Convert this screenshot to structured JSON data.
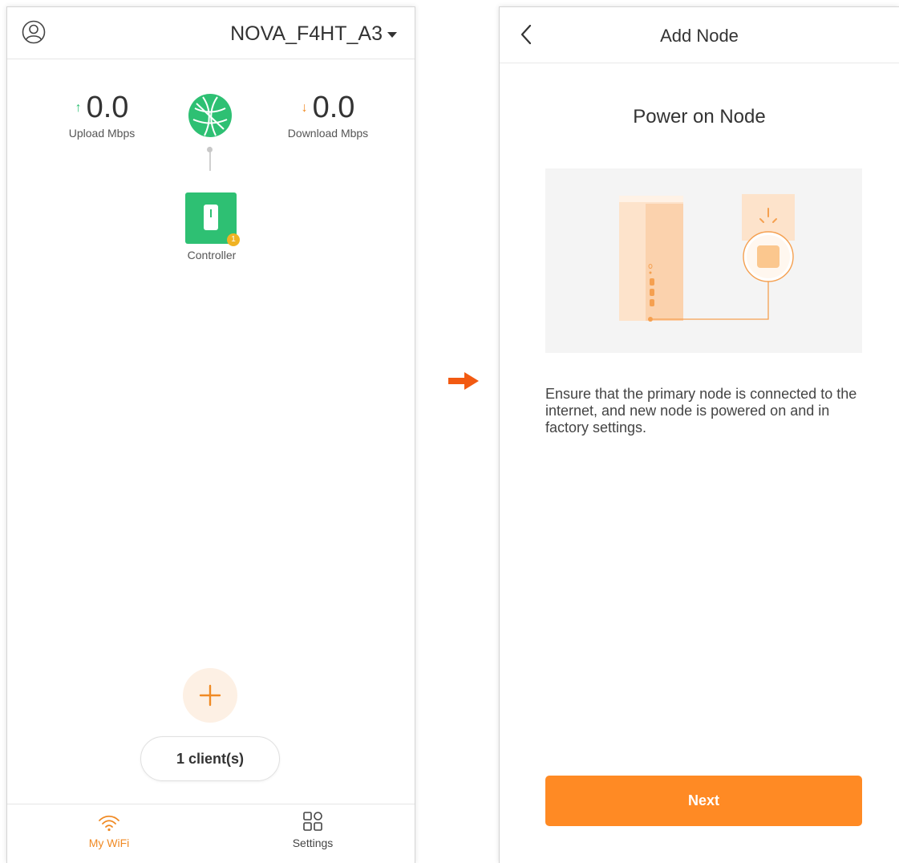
{
  "left_screen": {
    "header": {
      "ssid": "NOVA_F4HT_A3"
    },
    "upload": {
      "value": "0.0",
      "label": "Upload Mbps",
      "arrow": "↑"
    },
    "download": {
      "value": "0.0",
      "label": "Download Mbps",
      "arrow": "↓"
    },
    "controller": {
      "label": "Controller",
      "badge": "1"
    },
    "clients_button": {
      "label": "1 client(s)"
    },
    "tabs": [
      {
        "label": "My WiFi",
        "icon": "wifi-icon",
        "active": true
      },
      {
        "label": "Settings",
        "icon": "grid-icon",
        "active": false
      }
    ]
  },
  "right_screen": {
    "header": {
      "title": "Add Node"
    },
    "subtitle": "Power on Node",
    "description": "Ensure that the primary node is connected to the internet, and new node is powered on and in factory settings.",
    "next_button": {
      "label": "Next"
    }
  },
  "colors": {
    "accent_orange": "#ff8a24",
    "green": "#2ec073",
    "badge_yellow": "#f0b323",
    "arrow_orange": "#f25a12"
  }
}
